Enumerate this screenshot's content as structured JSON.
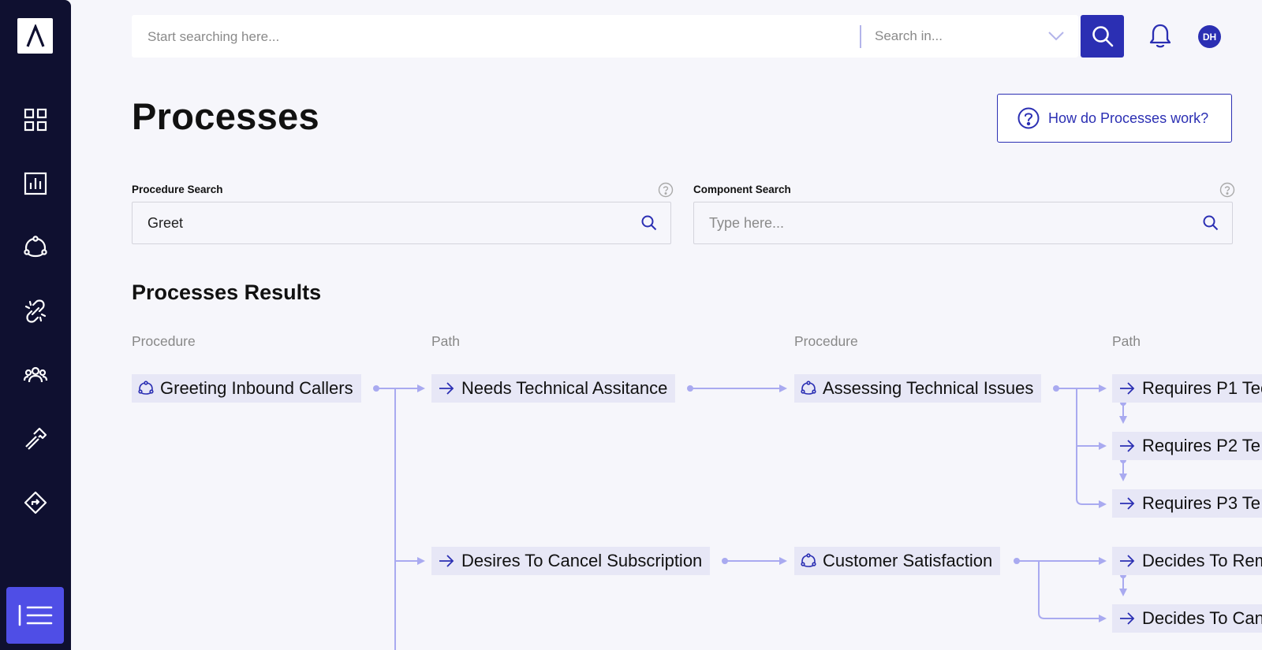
{
  "app": {
    "logo_icon": "logo-caret-icon",
    "accent": "#2b2fb3",
    "sidebar_bg": "#0f1030",
    "active_bg": "#4f4ee6"
  },
  "sidebar": {
    "items": [
      {
        "icon": "grid-icon"
      },
      {
        "icon": "bar-chart-icon"
      },
      {
        "icon": "process-cycle-icon"
      },
      {
        "icon": "broken-link-icon"
      },
      {
        "icon": "users-icon"
      },
      {
        "icon": "hammer-icon"
      },
      {
        "icon": "direction-sign-icon"
      },
      {
        "icon": "menu-icon",
        "active": true
      }
    ]
  },
  "topbar": {
    "search_placeholder": "Start searching here...",
    "search_in_placeholder": "Search in...",
    "avatar_initials": "DH"
  },
  "header": {
    "title": "Processes",
    "help_label": "How do Processes work?"
  },
  "filters": {
    "procedure": {
      "label": "Procedure Search",
      "value": "Greet"
    },
    "component": {
      "label": "Component Search",
      "placeholder": "Type here..."
    }
  },
  "results": {
    "title": "Processes Results",
    "columns": [
      "Procedure",
      "Path",
      "Procedure",
      "Path"
    ],
    "nodes": {
      "greeting": "Greeting Inbound Callers",
      "needs_tech": "Needs Technical Assitance",
      "cancel_sub": "Desires To Cancel Subscription",
      "assessing": "Assessing Technical Issues",
      "satisfaction": "Customer Satisfaction",
      "p1": "Requires P1 Tec",
      "p2": "Requires P2 Te",
      "p3": "Requires P3 Te",
      "decides_rem": "Decides To Rem",
      "decides_can": "Decides To Can"
    }
  }
}
